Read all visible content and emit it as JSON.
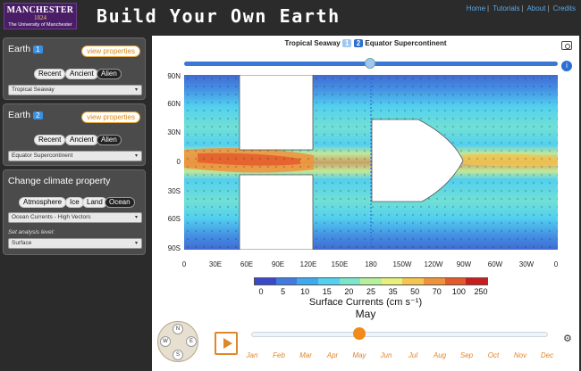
{
  "header": {
    "logo_top": "MANCHESTER",
    "logo_year": "1824",
    "logo_sub": "The University of Manchester",
    "title": "Build Your Own Earth",
    "nav": [
      "Home",
      "Tutorials",
      "About",
      "Credits"
    ]
  },
  "earth1": {
    "label": "Earth",
    "num": "1",
    "view_properties": "view properties",
    "tabs": [
      "Recent",
      "Ancient",
      "Alien"
    ],
    "active_tab": "Alien",
    "selected": "Tropical Seaway"
  },
  "earth2": {
    "label": "Earth",
    "num": "2",
    "view_properties": "view properties",
    "tabs": [
      "Recent",
      "Ancient",
      "Alien"
    ],
    "active_tab": "Alien",
    "selected": "Equator Supercontinent"
  },
  "climate": {
    "title": "Change climate property",
    "tabs": [
      "Atmosphere",
      "Ice",
      "Land",
      "Ocean"
    ],
    "active_tab": "Ocean",
    "selected": "Ocean Currents - High Vectors",
    "level_label": "Set analysis level:",
    "level_selected": "Surface"
  },
  "view": {
    "earth1_name": "Tropical Seaway",
    "earth1_num": "1",
    "earth2_num": "2",
    "earth2_name": "Equator Supercontinent",
    "colors": {
      "earth1": "#9fc7ef",
      "earth2": "#2b6fd1",
      "accent": "#e0862b"
    }
  },
  "map": {
    "yticks": [
      "90N",
      "60N",
      "30N",
      "0",
      "30S",
      "60S",
      "90S"
    ],
    "xticks": [
      "0",
      "30E",
      "60E",
      "90E",
      "120E",
      "150E",
      "180",
      "150W",
      "120W",
      "90W",
      "60W",
      "30W",
      "0"
    ]
  },
  "colorbar": {
    "title": "Surface Currents (cm s⁻¹)",
    "labels": [
      "0",
      "5",
      "10",
      "15",
      "20",
      "25",
      "35",
      "50",
      "70",
      "100",
      "250"
    ],
    "colors": [
      "#3a49c9",
      "#3f7be0",
      "#3fa9ee",
      "#52d0f0",
      "#7be6cc",
      "#b7ef9a",
      "#e6f07a",
      "#f4c64f",
      "#f0923a",
      "#e4582a",
      "#c91c1c"
    ]
  },
  "time": {
    "current_month": "May",
    "months": [
      "Jan",
      "Feb",
      "Mar",
      "Apr",
      "May",
      "Jun",
      "Jul",
      "Aug",
      "Sep",
      "Oct",
      "Nov",
      "Dec"
    ]
  },
  "compass": {
    "n": "N",
    "s": "S",
    "e": "E",
    "w": "W"
  }
}
